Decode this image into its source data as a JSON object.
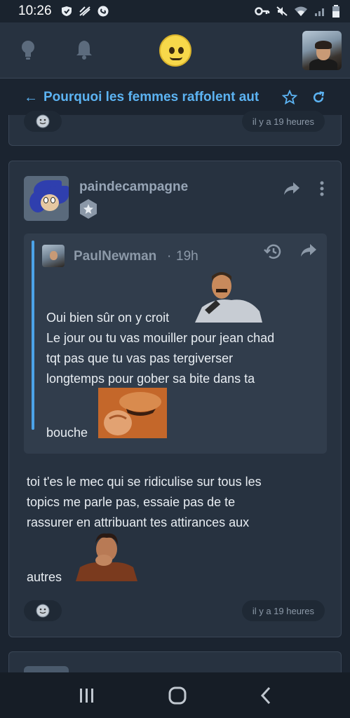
{
  "status_bar": {
    "time": "10:26"
  },
  "topic": {
    "title": "Pourquoi les femmes raffolent aut"
  },
  "prev_post": {
    "time": "il y a 19 heures"
  },
  "post": {
    "username": "paindecampagne",
    "quote": {
      "author": "PaulNewman",
      "separator": "·",
      "time": "19h",
      "line1": "Oui bien sûr on y croit",
      "line2": "Le jour ou tu vas mouiller pour jean chad",
      "line3": "tqt pas que tu vas pas tergiverser",
      "line4": "longtemps pour gober sa bite dans ta",
      "line5": "bouche"
    },
    "text_line1": "toi t'es le mec qui se ridiculise sur tous les",
    "text_line2": "topics me parle pas, essaie pas de te",
    "text_line3": "rassurer en attribuant tes attirances aux",
    "text_line4": "autres",
    "time": "il y a 19 heures"
  },
  "colors": {
    "accent": "#5cb3f2",
    "quote_bar": "#4ca3e8",
    "card_bg": "#273240",
    "page_bg": "#1b2430"
  },
  "icons": {
    "appbar": [
      "lightbulb-icon",
      "bell-icon",
      "smiley-logo",
      "user-avatar"
    ],
    "titlebar": [
      "arrow-left-icon",
      "star-outline-icon",
      "refresh-icon"
    ],
    "post_actions": [
      "share-icon",
      "more-vertical-icon"
    ],
    "quote_actions": [
      "history-icon",
      "share-icon"
    ],
    "navbar": [
      "recent-apps-icon",
      "home-icon",
      "back-chevron-icon"
    ]
  }
}
